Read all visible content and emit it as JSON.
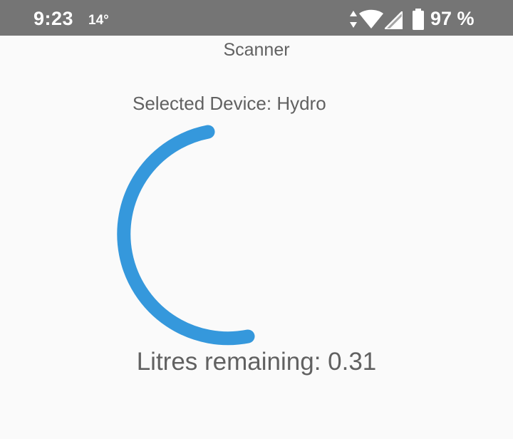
{
  "status_bar": {
    "time": "9:23",
    "temperature": "14°",
    "battery_percent": "97 %",
    "icons": [
      "data-arrows-icon",
      "wifi-icon",
      "cell-signal-icon",
      "battery-icon"
    ]
  },
  "screen": {
    "title": "Scanner",
    "selected_device_label": "Selected Device: Hydro",
    "litres_label": "Litres remaining: 0.31"
  },
  "progress_indicator": {
    "color": "#3598dc",
    "track": "none"
  },
  "colors": {
    "status_bar_bg": "#757575",
    "background": "#fafafa",
    "text": "#616161",
    "accent": "#3598dc"
  }
}
